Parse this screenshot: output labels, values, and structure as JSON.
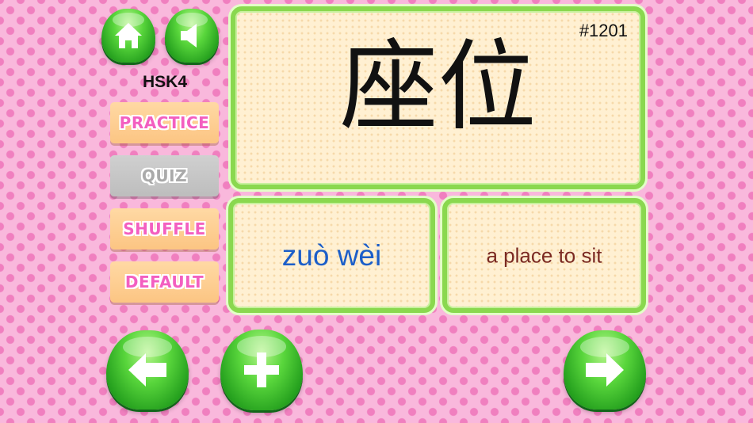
{
  "level": "HSK4",
  "menu": {
    "practice": "PRACTICE",
    "quiz": "QUIZ",
    "shuffle": "SHUFFLE",
    "default": "DEFAULT"
  },
  "card": {
    "number": "#1201",
    "hanzi": "座位",
    "pinyin": "zuò wèi",
    "meaning": "a place to sit"
  },
  "icons": {
    "home": "home-icon",
    "sound": "speaker-icon",
    "prev": "arrow-left-icon",
    "add": "plus-icon",
    "next": "arrow-right-icon"
  },
  "colors": {
    "background": "#f9b8dc",
    "dots": "#f07fbf",
    "gel_green": "#3cc02c",
    "card_border": "#8ad84f",
    "card_fill": "#fff0d2",
    "pinyin": "#1b5ec9",
    "meaning": "#7b2a22",
    "menu_orange": "#fcc583",
    "menu_text_pink": "#f35fc0",
    "quiz_grey": "#c7c7c7"
  }
}
